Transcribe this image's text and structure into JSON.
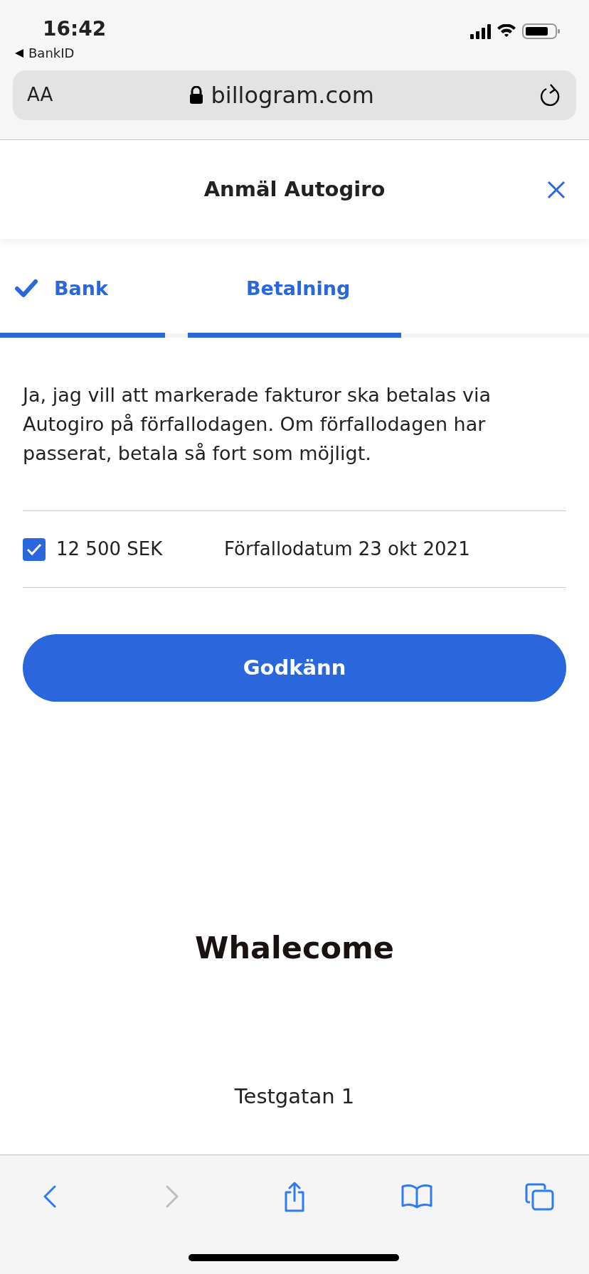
{
  "status_bar": {
    "time": "16:42",
    "back_app": "BankID"
  },
  "address_bar": {
    "text_size": "AA",
    "url": "billogram.com"
  },
  "header": {
    "title": "Anmäl Autogiro"
  },
  "steps": [
    {
      "label": "Bank",
      "done": true
    },
    {
      "label": "Betalning",
      "done": false
    }
  ],
  "consent_text": "Ja, jag vill att markerade fakturor ska betalas via Autogiro på förfallodagen. Om förfallodagen har passerat, betala så fort som möjligt.",
  "invoices": [
    {
      "checked": true,
      "amount": "12 500 SEK",
      "due": "Förfallodatum 23 okt 2021"
    }
  ],
  "approve_button": "Godkänn",
  "company": {
    "name": "Whalecome",
    "address": "Testgatan 1"
  },
  "toolbar": [
    {
      "kind": "back",
      "disabled": false
    },
    {
      "kind": "forward",
      "disabled": true
    },
    {
      "kind": "share",
      "disabled": false
    },
    {
      "kind": "bookmarks",
      "disabled": false
    },
    {
      "kind": "tabs",
      "disabled": false
    }
  ]
}
